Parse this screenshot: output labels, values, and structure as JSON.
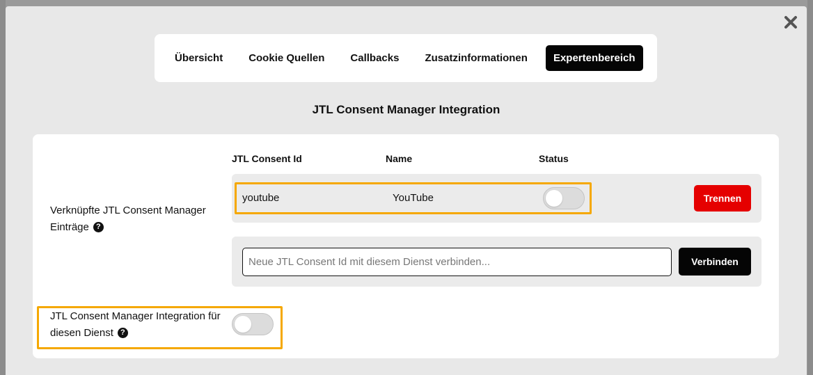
{
  "tabs": [
    {
      "label": "Übersicht",
      "active": false
    },
    {
      "label": "Cookie Quellen",
      "active": false
    },
    {
      "label": "Callbacks",
      "active": false
    },
    {
      "label": "Zusatzinformationen",
      "active": false
    },
    {
      "label": "Expertenbereich",
      "active": true
    }
  ],
  "section_title": "JTL Consent Manager Integration",
  "linked_entries": {
    "label_line1": "Verknüpfte JTL Consent Manager",
    "label_line2": "Einträge",
    "columns": {
      "id": "JTL Consent Id",
      "name": "Name",
      "status": "Status"
    },
    "rows": [
      {
        "id": "youtube",
        "name": "YouTube",
        "status_enabled": false,
        "disconnect_label": "Trennen"
      }
    ],
    "connect": {
      "placeholder": "Neue JTL Consent Id mit diesem Dienst verbinden...",
      "value": "",
      "button_label": "Verbinden"
    }
  },
  "integration_toggle": {
    "label_line1": "JTL Consent Manager Integration für",
    "label_line2": "diesen Dienst",
    "enabled": false
  },
  "help_icon_glyph": "?",
  "colors": {
    "highlight": "#f5a800",
    "danger": "#e50000",
    "dark_button": "#050505"
  }
}
